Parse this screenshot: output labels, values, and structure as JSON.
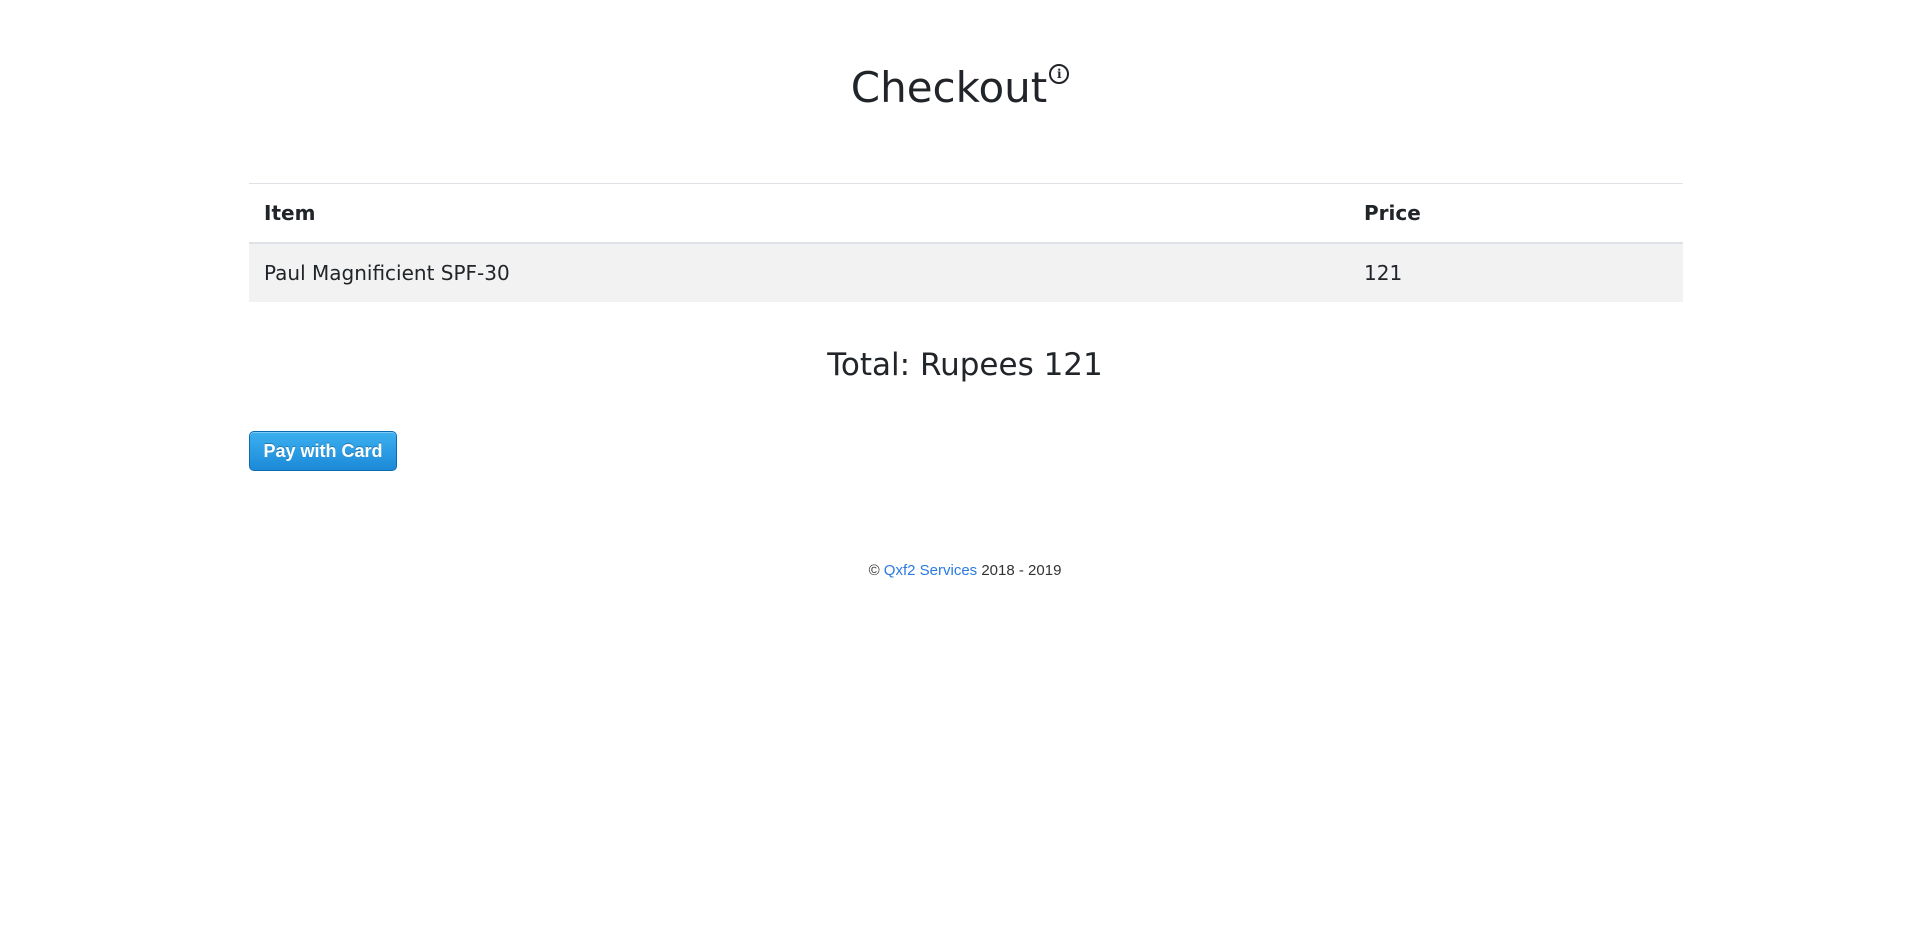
{
  "header": {
    "title": "Checkout",
    "info_icon": "info-circle-icon",
    "info_glyph": "i"
  },
  "cart": {
    "columns": [
      "Item",
      "Price"
    ],
    "rows": [
      {
        "item": "Paul Magnificient SPF-30",
        "price": "121"
      }
    ]
  },
  "summary": {
    "total_text": "Total: Rupees 121"
  },
  "payment": {
    "button_label": "Pay with Card",
    "button_color": "#1c8ad8"
  },
  "footer": {
    "copyright_symbol": "©",
    "company_link": "Qxf2 Services",
    "years": "2018 - 2019",
    "link_color": "#2a7ae2"
  }
}
